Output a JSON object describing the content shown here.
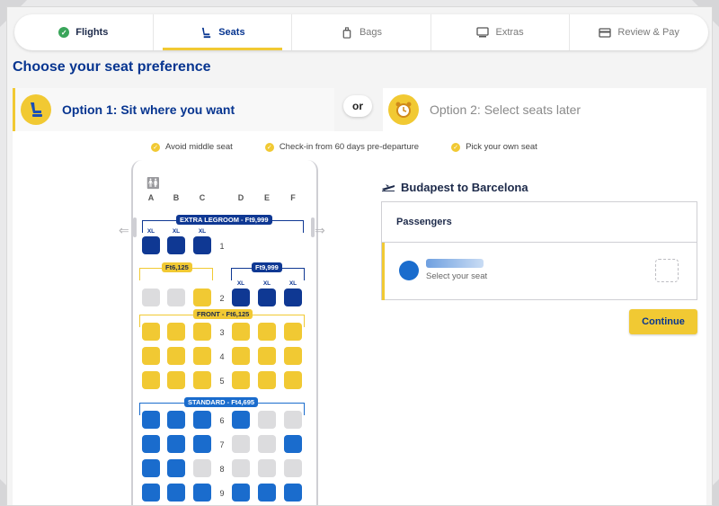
{
  "steps": [
    {
      "label": "Flights",
      "icon": "check-circle-icon",
      "state": "done"
    },
    {
      "label": "Seats",
      "icon": "seat-icon",
      "state": "active"
    },
    {
      "label": "Bags",
      "icon": "luggage-icon",
      "state": "pending"
    },
    {
      "label": "Extras",
      "icon": "extras-icon",
      "state": "pending"
    },
    {
      "label": "Review & Pay",
      "icon": "card-icon",
      "state": "pending"
    }
  ],
  "page_title": "Choose your seat preference",
  "option1": {
    "label": "Option 1: Sit where you want",
    "icon": "seat-icon"
  },
  "or_label": "or",
  "option2": {
    "label": "Option 2: Select seats later",
    "icon": "alarm-clock-icon"
  },
  "benefits": [
    "Avoid middle seat",
    "Check-in from 60 days pre-departure",
    "Pick your own seat"
  ],
  "seatmap": {
    "columns": [
      "A",
      "B",
      "C",
      "D",
      "E",
      "F"
    ],
    "bands": {
      "extra_legroom": "EXTRA LEGROOM - Ft9,999",
      "row2_left": "Ft6,125",
      "row2_right": "Ft9,999",
      "front": "FRONT - Ft6,125",
      "standard": "STANDARD - Ft4,695"
    },
    "xl_label": "XL",
    "rows": [
      {
        "num": "1",
        "seats": [
          "dark",
          "dark",
          "dark",
          "none",
          "none",
          "none"
        ],
        "xl": [
          true,
          true,
          true,
          false,
          false,
          false
        ]
      },
      {
        "num": "2",
        "seats": [
          "grey",
          "grey",
          "yellow",
          "dark",
          "dark",
          "dark"
        ],
        "xl": [
          false,
          false,
          false,
          true,
          true,
          true
        ]
      },
      {
        "num": "3",
        "seats": [
          "yellow",
          "yellow",
          "yellow",
          "yellow",
          "yellow",
          "yellow"
        ]
      },
      {
        "num": "4",
        "seats": [
          "yellow",
          "yellow",
          "yellow",
          "yellow",
          "yellow",
          "yellow"
        ]
      },
      {
        "num": "5",
        "seats": [
          "yellow",
          "yellow",
          "yellow",
          "yellow",
          "yellow",
          "yellow"
        ]
      },
      {
        "num": "6",
        "seats": [
          "blue",
          "blue",
          "blue",
          "blue",
          "grey",
          "grey"
        ]
      },
      {
        "num": "7",
        "seats": [
          "blue",
          "blue",
          "blue",
          "grey",
          "grey",
          "blue"
        ]
      },
      {
        "num": "8",
        "seats": [
          "blue",
          "blue",
          "grey",
          "grey",
          "grey",
          "grey"
        ]
      },
      {
        "num": "9",
        "seats": [
          "blue",
          "blue",
          "blue",
          "blue",
          "blue",
          "blue"
        ]
      }
    ]
  },
  "flight": {
    "route": "Budapest to Barcelona",
    "icon": "plane-icon"
  },
  "passengers": {
    "header": "Passengers",
    "items": [
      {
        "subtitle": "Select your seat"
      }
    ]
  },
  "continue_label": "Continue",
  "colors": {
    "navy": "#073590",
    "yellow": "#f1c933",
    "blue": "#1a6ccd",
    "dark_blue": "#0f3893",
    "grey_seat": "#dcdcde"
  }
}
